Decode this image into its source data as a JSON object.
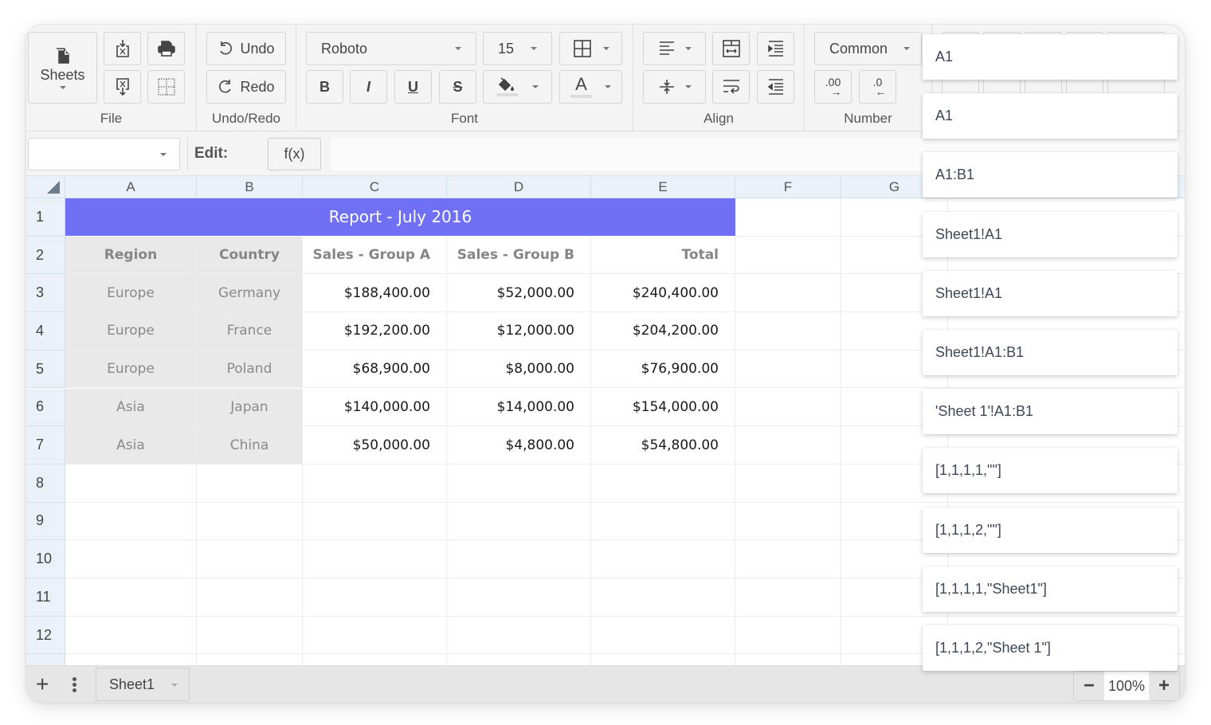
{
  "toolbar": {
    "file": {
      "label": "File",
      "sheets_label": "Sheets",
      "buttons": [
        "import-excel",
        "print",
        "export-excel",
        "show-gridlines"
      ]
    },
    "undo_redo": {
      "label": "Undo/Redo",
      "undo_label": "Undo",
      "redo_label": "Redo"
    },
    "font": {
      "label": "Font",
      "family_value": "Roboto",
      "size_value": "15",
      "bold_label": "B",
      "italic_label": "I",
      "underline_label": "U",
      "strike_label": "S",
      "text_color_glyph": "A"
    },
    "align": {
      "label": "Align"
    },
    "number": {
      "label": "Number",
      "format_value": "Common",
      "increase_decimals_glyph": ".00",
      "decrease_decimals_glyph": ".0"
    }
  },
  "formula_bar": {
    "namebox_value": "",
    "edit_label": "Edit:",
    "fx_label": "f(x)",
    "formula_value": ""
  },
  "grid": {
    "columns": [
      "A",
      "B",
      "C",
      "D",
      "E",
      "F",
      "G"
    ],
    "rows": [
      "1",
      "2",
      "3",
      "4",
      "5",
      "6",
      "7",
      "8",
      "9",
      "10",
      "11",
      "12"
    ],
    "title": "Report - July 2016",
    "title_color": "#7070f5",
    "headers": [
      "Region",
      "Country",
      "Sales - Group A",
      "Sales - Group B",
      "Total"
    ],
    "data": [
      [
        "Europe",
        "Germany",
        "$188,400.00",
        "$52,000.00",
        "$240,400.00"
      ],
      [
        "Europe",
        "France",
        "$192,200.00",
        "$12,000.00",
        "$204,200.00"
      ],
      [
        "Europe",
        "Poland",
        "$68,900.00",
        "$8,000.00",
        "$76,900.00"
      ],
      [
        "Asia",
        "Japan",
        "$140,000.00",
        "$14,000.00",
        "$154,000.00"
      ],
      [
        "Asia",
        "China",
        "$50,000.00",
        "$4,800.00",
        "$54,800.00"
      ]
    ]
  },
  "bottombar": {
    "add_sheet_glyph": "+",
    "sheet_tab_label": "Sheet1",
    "zoom_minus": "−",
    "zoom_value": "100%",
    "zoom_plus": "+"
  },
  "popup_items": [
    "A1",
    "A1",
    "A1:B1",
    "Sheet1!A1",
    "Sheet1!A1",
    "Sheet1!A1:B1",
    "'Sheet 1'!A1:B1",
    "[1,1,1,1,\"\"]",
    "[1,1,1,2,\"\"]",
    "[1,1,1,1,\"Sheet1\"]",
    "[1,1,1,2,\"Sheet 1\"]"
  ]
}
